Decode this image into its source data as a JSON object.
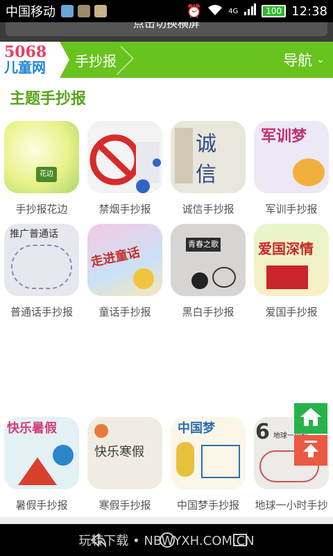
{
  "status": {
    "carrier": "中国移动",
    "battery": "100",
    "network": "4G",
    "time": "12:38"
  },
  "banner": {
    "text": "点击切换横屏"
  },
  "header": {
    "logo_num": "5068",
    "logo_text": "儿童网",
    "crumb": "手抄报",
    "nav_label": "导航",
    "accent": "#69c31f"
  },
  "section_title": "主题手抄报",
  "rows": [
    [
      {
        "label": "手抄报花边",
        "icon": "flower-border-icon"
      },
      {
        "label": "禁烟手抄报",
        "icon": "no-smoking-icon"
      },
      {
        "label": "诚信手抄报",
        "icon": "honesty-icon"
      },
      {
        "label": "军训手抄报",
        "icon": "military-training-icon"
      }
    ],
    [
      {
        "label": "普通话手抄报",
        "icon": "mandarin-icon"
      },
      {
        "label": "童话手抄报",
        "icon": "fairy-tale-icon"
      },
      {
        "label": "黑白手抄报",
        "icon": "black-white-icon"
      },
      {
        "label": "爱国手抄报",
        "icon": "patriotic-icon"
      }
    ],
    [
      {
        "label": "暑假手抄报",
        "icon": "summer-holiday-icon"
      },
      {
        "label": "寒假手抄报",
        "icon": "winter-holiday-icon"
      },
      {
        "label": "中国梦手抄报",
        "icon": "china-dream-icon"
      },
      {
        "label": "地球一小时手抄",
        "icon": "earth-hour-icon"
      }
    ]
  ],
  "bottom": {
    "watermark": "玩转下载 • NBWYXH.COM.CN"
  }
}
